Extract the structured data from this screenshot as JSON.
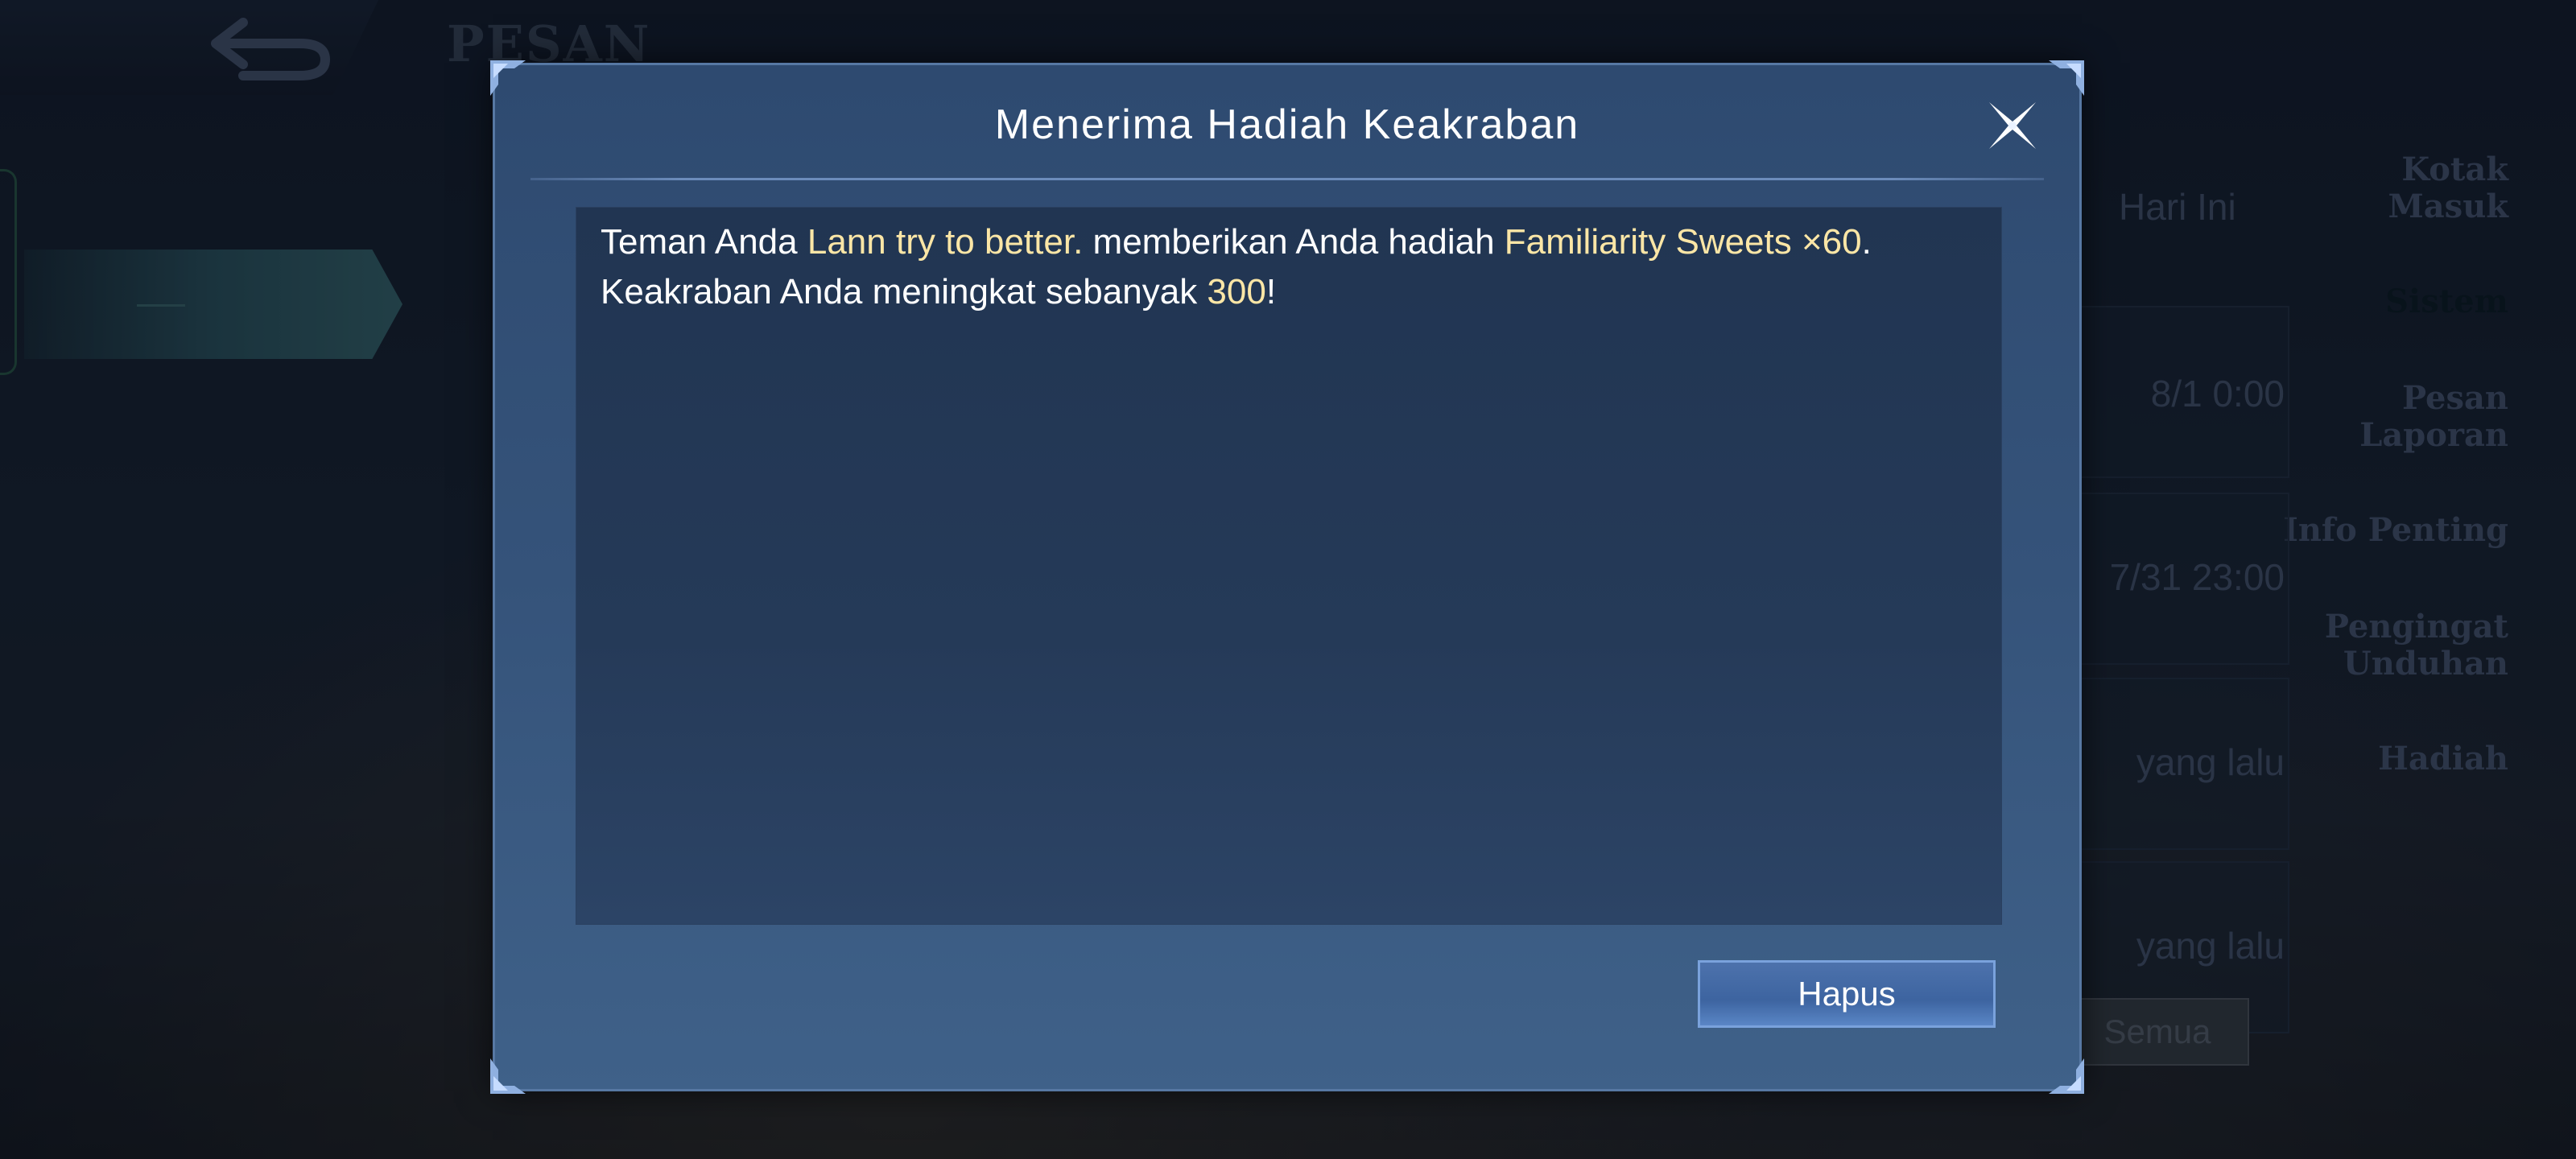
{
  "background": {
    "page_title": "PESAN",
    "sidebar": {
      "items": [
        {
          "label": "Kotak\nMasuk",
          "active": false
        },
        {
          "label": "Sistem",
          "active": true
        },
        {
          "label": "Pesan\nLaporan",
          "active": false
        },
        {
          "label": "Info Penting",
          "active": false
        },
        {
          "label": "Pengingat\nUnduhan",
          "active": false
        },
        {
          "label": "Hadiah",
          "active": false
        }
      ]
    },
    "list": {
      "today_label": "Hari Ini",
      "rows": [
        {
          "time": "8/1 0:00"
        },
        {
          "time": "7/31 23:00"
        },
        {
          "time": "yang lalu"
        },
        {
          "time": "yang lalu"
        }
      ],
      "bottom_button": "Semua"
    }
  },
  "dialog": {
    "title": "Menerima Hadiah Keakraban",
    "message": {
      "part1": "Teman Anda ",
      "friend_name": "Lann try to better.",
      "part2": " memberikan Anda hadiah ",
      "item": "Familiarity Sweets ×60",
      "part3": ".",
      "line2_prefix": "Keakraban Anda meningkat sebanyak ",
      "amount": "300",
      "line2_suffix": "!"
    },
    "delete_button": "Hapus",
    "highlight_color": "#fbe6a6"
  }
}
